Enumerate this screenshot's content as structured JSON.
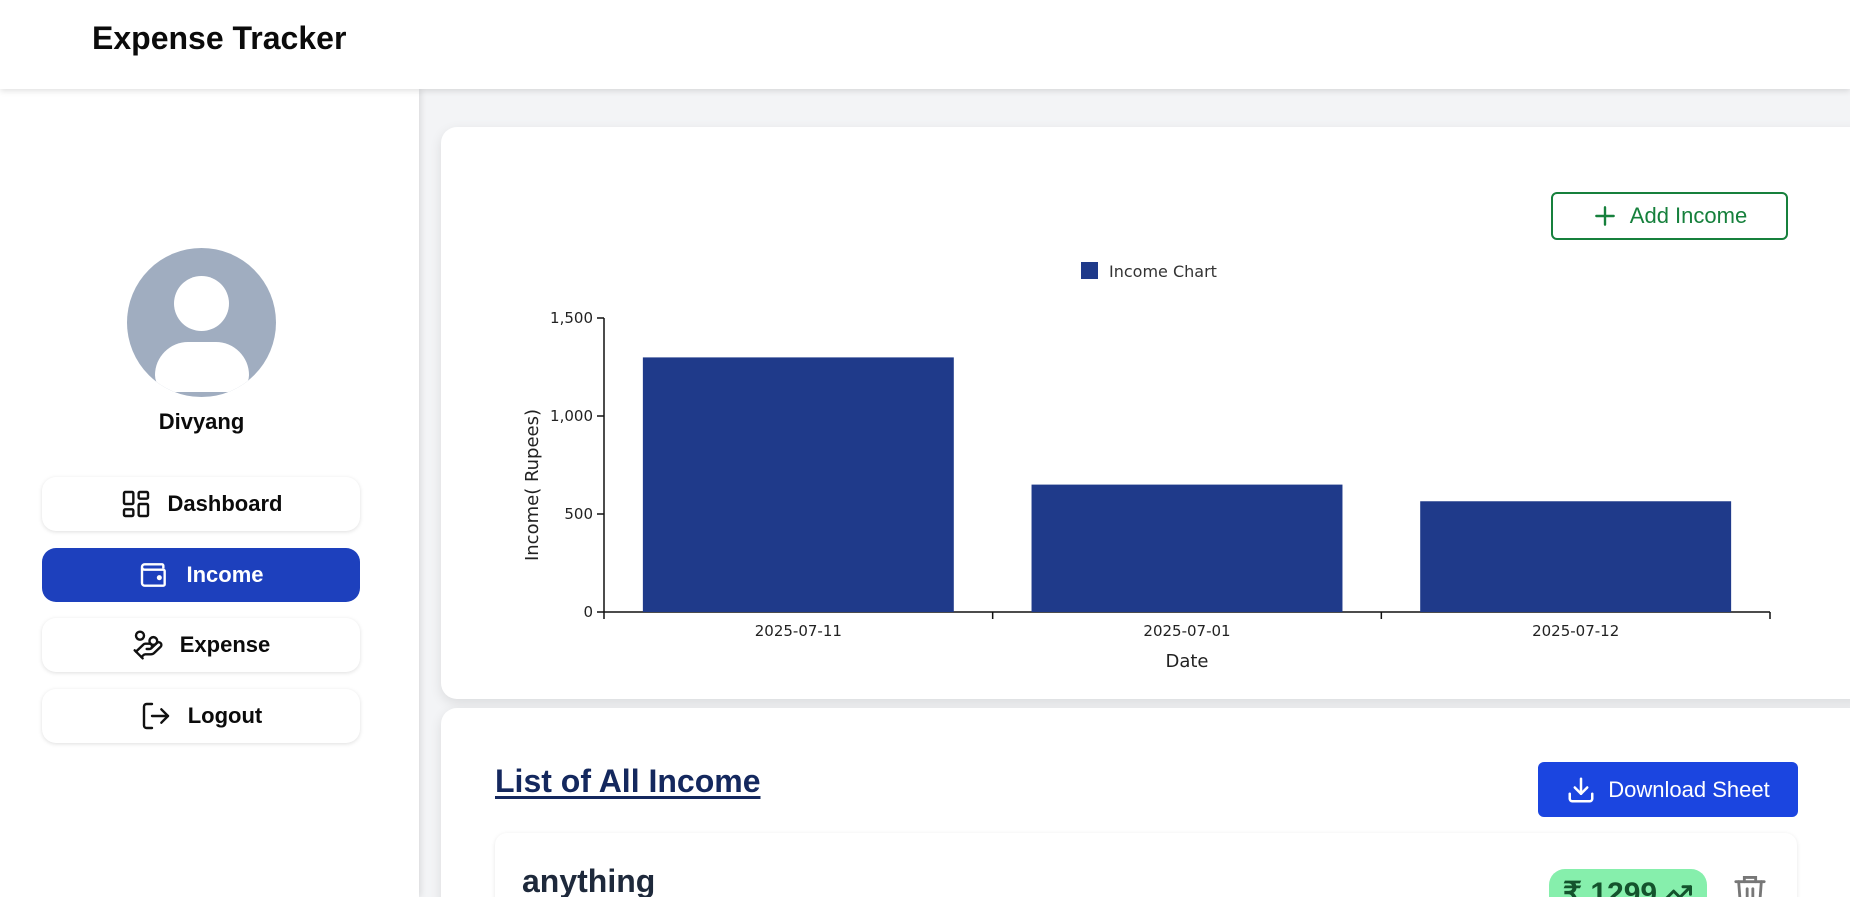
{
  "app": {
    "title": "Expense Tracker"
  },
  "user": {
    "name": "Divyang"
  },
  "sidebar": {
    "items": [
      {
        "label": "Dashboard",
        "icon": "dashboard-grid-icon",
        "active": false
      },
      {
        "label": "Income",
        "icon": "wallet-icon",
        "active": true
      },
      {
        "label": "Expense",
        "icon": "hand-coins-icon",
        "active": false
      },
      {
        "label": "Logout",
        "icon": "logout-icon",
        "active": false
      }
    ]
  },
  "chart_section": {
    "add_button_label": "Add Income"
  },
  "chart_data": {
    "type": "bar",
    "categories": [
      "2025-07-11",
      "2025-07-01",
      "2025-07-12"
    ],
    "series": [
      {
        "name": "Income Chart",
        "values": [
          1299,
          650,
          565
        ]
      }
    ],
    "title": "",
    "xlabel": "Date",
    "ylabel": "Income( Rupees)",
    "ylim": [
      0,
      1500
    ],
    "yticks": [
      0,
      500,
      1000,
      1500
    ],
    "ytick_labels": [
      "0",
      "500",
      "1,000",
      "1,500"
    ],
    "grid": false,
    "legend": "top-center",
    "bar_color": "#1f3a8a"
  },
  "income_list": {
    "title": "List of All Income",
    "download_label": "Download Sheet",
    "items": [
      {
        "title": "anything",
        "amount": "₹ 1299"
      }
    ]
  },
  "colors": {
    "primary": "#1d40bd",
    "download": "#1b45e0",
    "add_income": "#16803c",
    "amount_badge": "#86efac",
    "bar": "#1f3a8a"
  }
}
